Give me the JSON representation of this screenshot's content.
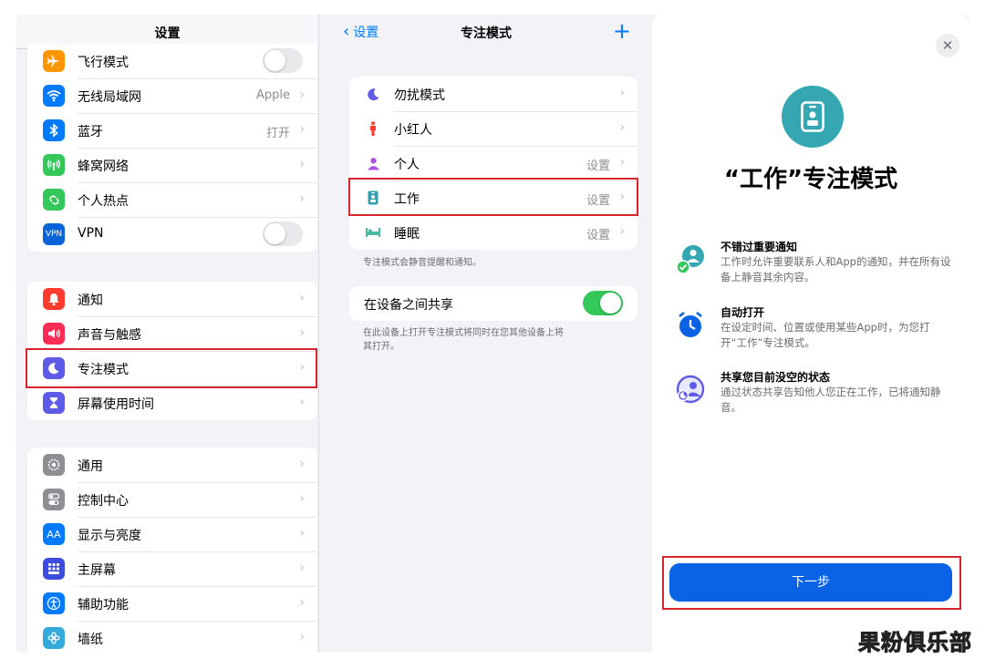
{
  "settings": {
    "title": "设置",
    "group1": [
      {
        "label": "飞行模式",
        "icon": "airplane-icon",
        "color": "#ff9500",
        "toggle": false
      },
      {
        "label": "无线局域网",
        "icon": "wifi-icon",
        "color": "#007aff",
        "value": "Apple"
      },
      {
        "label": "蓝牙",
        "icon": "bluetooth-icon",
        "color": "#007aff",
        "value": "打开"
      },
      {
        "label": "蜂窝网络",
        "icon": "cellular-icon",
        "color": "#34c759"
      },
      {
        "label": "个人热点",
        "icon": "hotspot-icon",
        "color": "#34c759"
      },
      {
        "label": "VPN",
        "icon": "vpn-icon",
        "color": "#0a64d8",
        "icon_text": "VPN",
        "toggle": false
      }
    ],
    "group2": [
      {
        "label": "通知",
        "icon": "bell-icon",
        "color": "#ff3b30"
      },
      {
        "label": "声音与触感",
        "icon": "speaker-icon",
        "color": "#ff2d55"
      },
      {
        "label": "专注模式",
        "icon": "moon-icon",
        "color": "#5e5ce6"
      },
      {
        "label": "屏幕使用时间",
        "icon": "hourglass-icon",
        "color": "#5e5ce6"
      }
    ],
    "group3": [
      {
        "label": "通用",
        "icon": "gear-icon",
        "color": "#8e8e93"
      },
      {
        "label": "控制中心",
        "icon": "switches-icon",
        "color": "#8e8e93"
      },
      {
        "label": "显示与亮度",
        "icon": "display-icon",
        "color": "#007aff",
        "icon_text": "AA"
      },
      {
        "label": "主屏幕",
        "icon": "home-screen-icon",
        "color": "#3c4ce0"
      },
      {
        "label": "辅助功能",
        "icon": "accessibility-icon",
        "color": "#007aff"
      },
      {
        "label": "墙纸",
        "icon": "wallpaper-icon",
        "color": "#34aadc"
      }
    ]
  },
  "focus": {
    "back_label": "设置",
    "title": "专注模式",
    "add_icon": "plus-icon",
    "modes": [
      {
        "label": "勿扰模式",
        "icon": "moon-icon",
        "color": "#5e5ce6",
        "value": ""
      },
      {
        "label": "小红人",
        "icon": "person-standing-icon",
        "color": "#ff3b30",
        "value": ""
      },
      {
        "label": "个人",
        "icon": "person-icon",
        "color": "#af52de",
        "value": "设置"
      },
      {
        "label": "工作",
        "icon": "badge-icon",
        "color": "#30a0b0",
        "value": "设置"
      },
      {
        "label": "睡眠",
        "icon": "bed-icon",
        "color": "#4cb9a5",
        "value": "设置"
      }
    ],
    "modes_footer": "专注模式会静音提醒和通知。",
    "share_label": "在设备之间共享",
    "share_on": true,
    "share_footer_1": "在此设备上打开专注模式将同时在您其他设备上将",
    "share_footer_2": "其打开。"
  },
  "intro": {
    "close_icon": "close-icon",
    "title": "“工作”专注模式",
    "features": [
      {
        "title": "不错过重要通知",
        "desc": "工作时允许重要联系人和App的通知，并在所有设备上静音其余内容。"
      },
      {
        "title": "自动打开",
        "desc": "在设定时间、位置或使用某些App时，为您打开“工作”专注模式。"
      },
      {
        "title": "共享您目前没空的状态",
        "desc": "通过状态共享告知他人您正在工作，已将通知静音。"
      }
    ],
    "next_label": "下一步"
  },
  "watermark": "果粉俱乐部",
  "colors": {
    "accent": "#007aff",
    "button": "#0a63e4",
    "highlight": "#d9232d",
    "toggle_on": "#34c759"
  }
}
